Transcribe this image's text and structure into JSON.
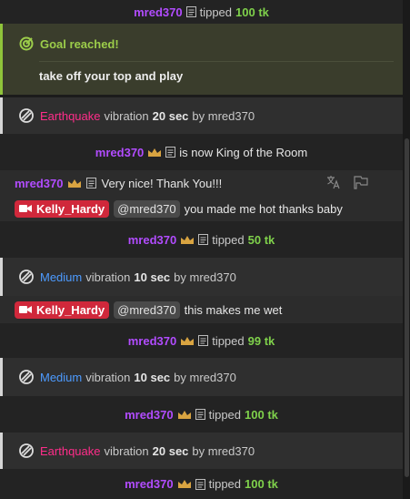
{
  "rows": {
    "tip1": {
      "user": "mred370",
      "action": "tipped",
      "amount": "100 tk"
    },
    "goal": {
      "title": "Goal reached!",
      "message": "take off your top and play"
    },
    "vib1": {
      "level": "Earthquake",
      "level_color": "#ff2d8a",
      "text": "vibration",
      "duration": "20 sec",
      "by": "by mred370"
    },
    "king": {
      "user": "mred370",
      "text": "is now King of the Room"
    },
    "chat1": {
      "user": "mred370",
      "message": "Very nice! Thank You!!!"
    },
    "chat2": {
      "user": "Kelly_Hardy",
      "mention": "@mred370",
      "message": "you made me hot thanks baby"
    },
    "tip2": {
      "user": "mred370",
      "action": "tipped",
      "amount": "50 tk"
    },
    "vib2": {
      "level": "Medium",
      "level_color": "#4d9bff",
      "text": "vibration",
      "duration": "10 sec",
      "by": "by mred370"
    },
    "chat3": {
      "user": "Kelly_Hardy",
      "mention": "@mred370",
      "message": "this makes me wet"
    },
    "tip3": {
      "user": "mred370",
      "action": "tipped",
      "amount": "99 tk"
    },
    "vib3": {
      "level": "Medium",
      "level_color": "#4d9bff",
      "text": "vibration",
      "duration": "10 sec",
      "by": "by mred370"
    },
    "tip4": {
      "user": "mred370",
      "action": "tipped",
      "amount": "100 tk"
    },
    "vib4": {
      "level": "Earthquake",
      "level_color": "#ff2d8a",
      "text": "vibration",
      "duration": "20 sec",
      "by": "by mred370"
    },
    "tip5": {
      "user": "mred370",
      "action": "tipped",
      "amount": "100 tk"
    }
  },
  "icons": {
    "crown": "crown-icon",
    "note": "notes-icon",
    "target": "target-icon",
    "vibration": "vibration-icon",
    "translate": "translate-icon",
    "flag": "flag-icon",
    "camera": "video-camera-icon"
  },
  "colors": {
    "user": "#b24cff",
    "amount": "#7fd14b",
    "goal_accent": "#8fc43a",
    "badge": "#d0283b"
  }
}
